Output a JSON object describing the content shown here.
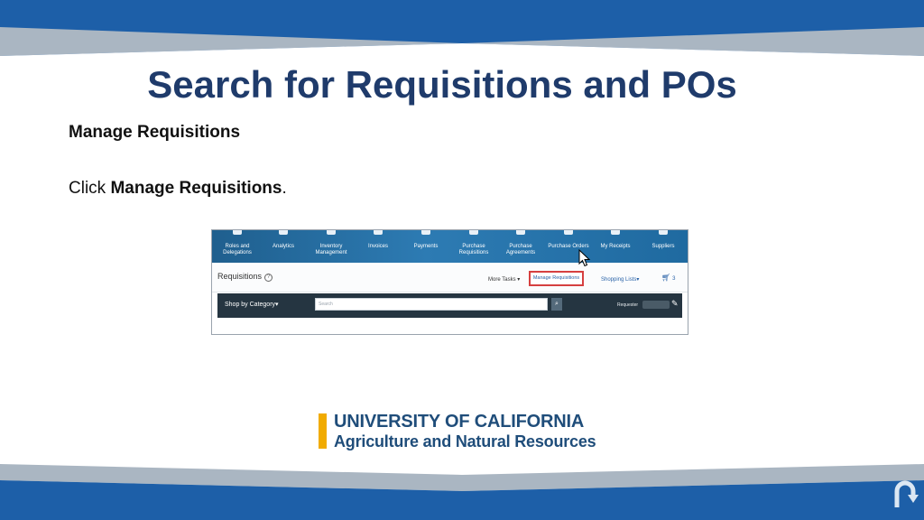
{
  "slide": {
    "title": "Search for Requisitions and POs",
    "subheading": "Manage Requisitions",
    "instruction_prefix": "Click ",
    "instruction_bold": "Manage Requisitions",
    "instruction_suffix": "."
  },
  "screenshot": {
    "nav_items": [
      {
        "label": "Roles and Delegations"
      },
      {
        "label": "Analytics"
      },
      {
        "label": "Inventory Management"
      },
      {
        "label": "Invoices"
      },
      {
        "label": "Payments"
      },
      {
        "label": "Purchase Requisitions"
      },
      {
        "label": "Purchase Agreements"
      },
      {
        "label": "Purchase Orders"
      },
      {
        "label": "My Receipts"
      },
      {
        "label": "Suppliers"
      }
    ],
    "requisitions_title": "Requisitions",
    "help_glyph": "?",
    "more_tasks": "More Tasks",
    "manage_requisitions": "Manage Requisitions",
    "shopping_lists": "Shopping Lists",
    "cart_count": "3",
    "shop_by_category": "Shop by Category",
    "search_placeholder": "Search",
    "requester_label": "Requester"
  },
  "logo": {
    "line1": "UNIVERSITY OF CALIFORNIA",
    "line2": "Agriculture and Natural Resources"
  },
  "colors": {
    "title": "#1f3b6b",
    "band_blue": "#1d5fa8",
    "logo_gold": "#f1ab00",
    "logo_blue": "#1f4d7a",
    "highlight_red": "#d64040"
  }
}
